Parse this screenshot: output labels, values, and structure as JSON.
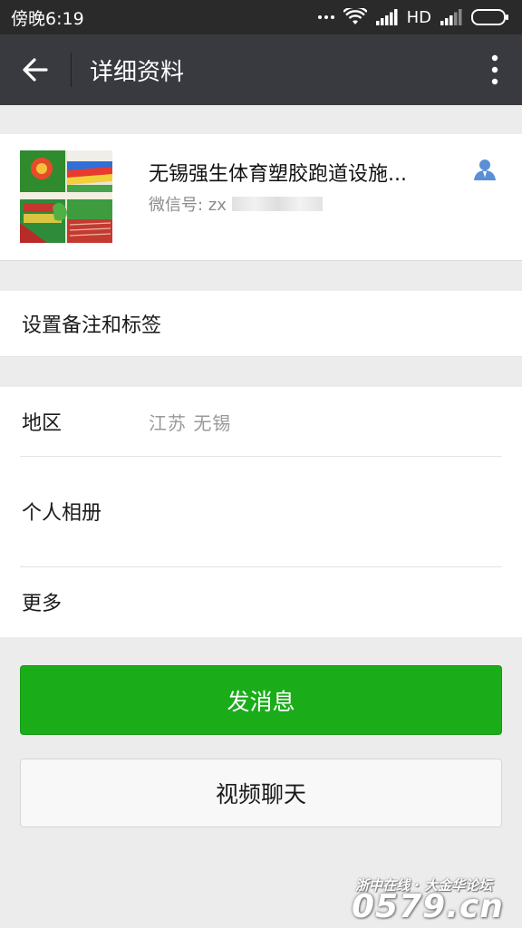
{
  "status_bar": {
    "time": "傍晚6:19",
    "network": "HD",
    "icons": [
      "more-dots-icon",
      "wifi-icon",
      "signal-icon",
      "signal-icon",
      "battery-icon"
    ]
  },
  "header": {
    "title": "详细资料",
    "back_icon": "back-arrow-icon",
    "menu_icon": "more-vertical-icon"
  },
  "profile": {
    "name": "无锡强生体育塑胶跑道设施...",
    "wechat_id_label": "微信号: zx",
    "contact_icon": "person-icon"
  },
  "remark": {
    "label": "设置备注和标签"
  },
  "info": {
    "region_label": "地区",
    "region_value": "江苏  无锡",
    "album_label": "个人相册",
    "more_label": "更多"
  },
  "actions": {
    "send_message": "发消息",
    "video_call": "视频聊天"
  },
  "colors": {
    "title_bar": "#393a3f",
    "status_bar": "#2a2a2a",
    "primary_button": "#1aad19",
    "background": "#ececec"
  },
  "watermark": {
    "top_text": "浙中在线 · 大金华论坛",
    "main_text": "0579.cn"
  }
}
